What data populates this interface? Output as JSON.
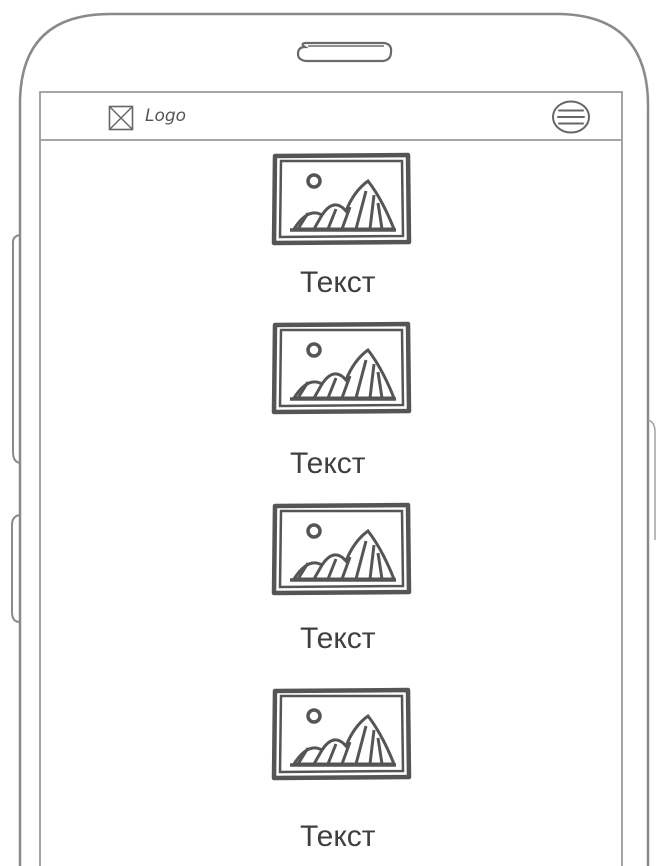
{
  "header": {
    "logo_label": "Logo",
    "logo_icon": "image-placeholder-icon",
    "menu_icon": "hamburger-menu-icon"
  },
  "items": [
    {
      "label": "Текст",
      "icon": "image-icon"
    },
    {
      "label": "Текст",
      "icon": "image-icon"
    },
    {
      "label": "Текст",
      "icon": "image-icon"
    },
    {
      "label": "Текст",
      "icon": "image-icon"
    }
  ],
  "colors": {
    "sketch_stroke": "#555555",
    "phone_outline": "#8a8a8a",
    "text": "#3f3f3f",
    "background": "#ffffff"
  }
}
